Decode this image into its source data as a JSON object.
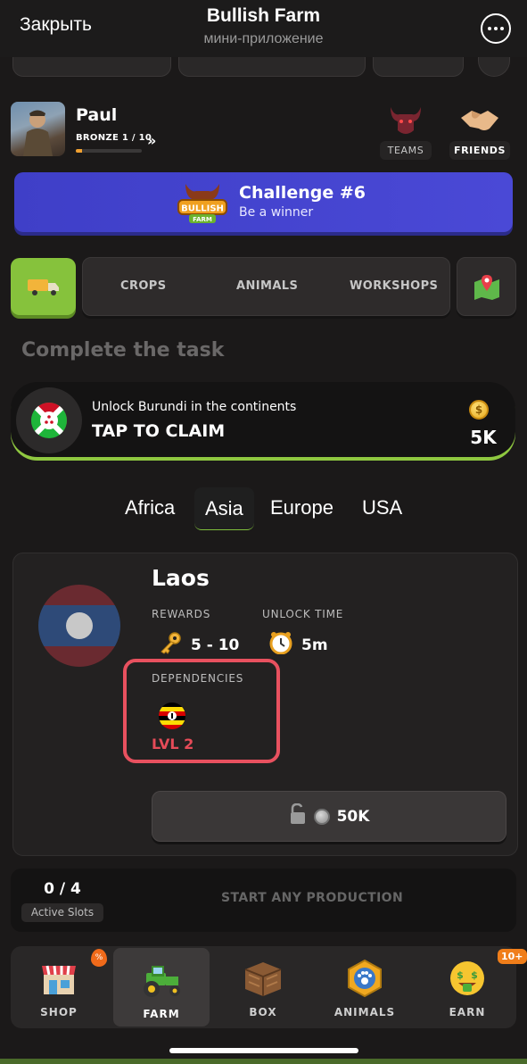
{
  "topbar": {
    "close_label": "Закрыть",
    "title": "Bullish Farm",
    "subtitle": "мини-приложение",
    "more_icon": "more-icon"
  },
  "profile": {
    "name": "Paul",
    "rank": "BRONZE 1 / 10",
    "rank_progress": 0.1,
    "teams_label": "TEAMS",
    "friends_label": "FRIENDS"
  },
  "challenge": {
    "logo_text": "BULLISH FARM",
    "title": "Challenge #6",
    "subtitle": "Be a winner"
  },
  "categories": {
    "tabs": [
      "CROPS",
      "ANIMALS",
      "WORKSHOPS"
    ]
  },
  "task": {
    "section_title": "Complete the task",
    "text": "Unlock Burundi in the continents",
    "cta": "TAP TO CLAIM",
    "reward": "5K",
    "coin_symbol": "$"
  },
  "regions": {
    "tabs": [
      "Africa",
      "Asia",
      "Europe",
      "USA"
    ],
    "active": "Asia"
  },
  "country": {
    "name": "Laos",
    "rewards_label": "REWARDS",
    "rewards_value": "5 - 10",
    "unlock_time_label": "UNLOCK TIME",
    "unlock_time_value": "5m",
    "dependencies_label": "DEPENDENCIES",
    "dependency_level": "LVL 2",
    "unlock_cost": "50K"
  },
  "production": {
    "slots": "0 / 4",
    "slots_label": "Active Slots",
    "cta": "START ANY PRODUCTION"
  },
  "nav": {
    "items": [
      "SHOP",
      "FARM",
      "BOX",
      "ANIMALS",
      "EARN"
    ],
    "active": "FARM",
    "earn_badge": "10+",
    "shop_badge": "%"
  },
  "colors": {
    "accent_green": "#86c23c",
    "challenge_blue": "#4443d0",
    "highlight_red": "#e8515f",
    "level_red": "#e64b58"
  }
}
